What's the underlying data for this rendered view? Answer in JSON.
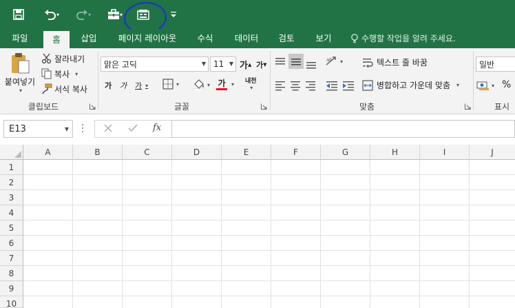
{
  "qat": {
    "save_icon": "save-icon",
    "undo_icon": "undo-icon",
    "redo_icon": "redo-icon",
    "briefcase_icon": "briefcase-icon",
    "form_icon": "form-icon",
    "customize_icon": "customize-qat-icon",
    "highlight_color": "#1a2fd6"
  },
  "tabs": [
    {
      "label": "파일"
    },
    {
      "label": "홈"
    },
    {
      "label": "삽입"
    },
    {
      "label": "페이지 레이아웃"
    },
    {
      "label": "수식"
    },
    {
      "label": "데이터"
    },
    {
      "label": "검토"
    },
    {
      "label": "보기"
    }
  ],
  "tell_me": {
    "placeholder": "수행할 작업을 알려 주세요."
  },
  "ribbon": {
    "clipboard": {
      "paste_label": "붙여넣기",
      "cut_label": "잘라내기",
      "copy_label": "복사",
      "format_painter_label": "서식 복사",
      "group_label": "클립보드"
    },
    "font": {
      "font_name": "맑은 고딕",
      "font_size": "11",
      "grow_label": "가",
      "shrink_label": "가",
      "bold_label": "가",
      "italic_label": "가",
      "underline_label": "가",
      "font_color_label": "가",
      "phonetic_label": "내천",
      "group_label": "글꼴",
      "font_color": "#e81123"
    },
    "alignment": {
      "wrap_text_label": "텍스트 줄 바꿈",
      "merge_center_label": "병합하고 가운데 맞춤",
      "group_label": "맞춤"
    },
    "number": {
      "format": "일반",
      "percent_label": "%",
      "group_label": "표시"
    }
  },
  "formula_bar": {
    "name_box": "E13",
    "fx_label": "fx",
    "formula": ""
  },
  "grid": {
    "columns": [
      "A",
      "B",
      "C",
      "D",
      "E",
      "F",
      "G",
      "H",
      "I",
      "J"
    ],
    "rows": [
      "1",
      "2",
      "3",
      "4",
      "5",
      "6",
      "7",
      "8",
      "9",
      "10"
    ]
  },
  "colors": {
    "excel_green": "#217346",
    "ribbon_bg": "#f3f3f3"
  }
}
